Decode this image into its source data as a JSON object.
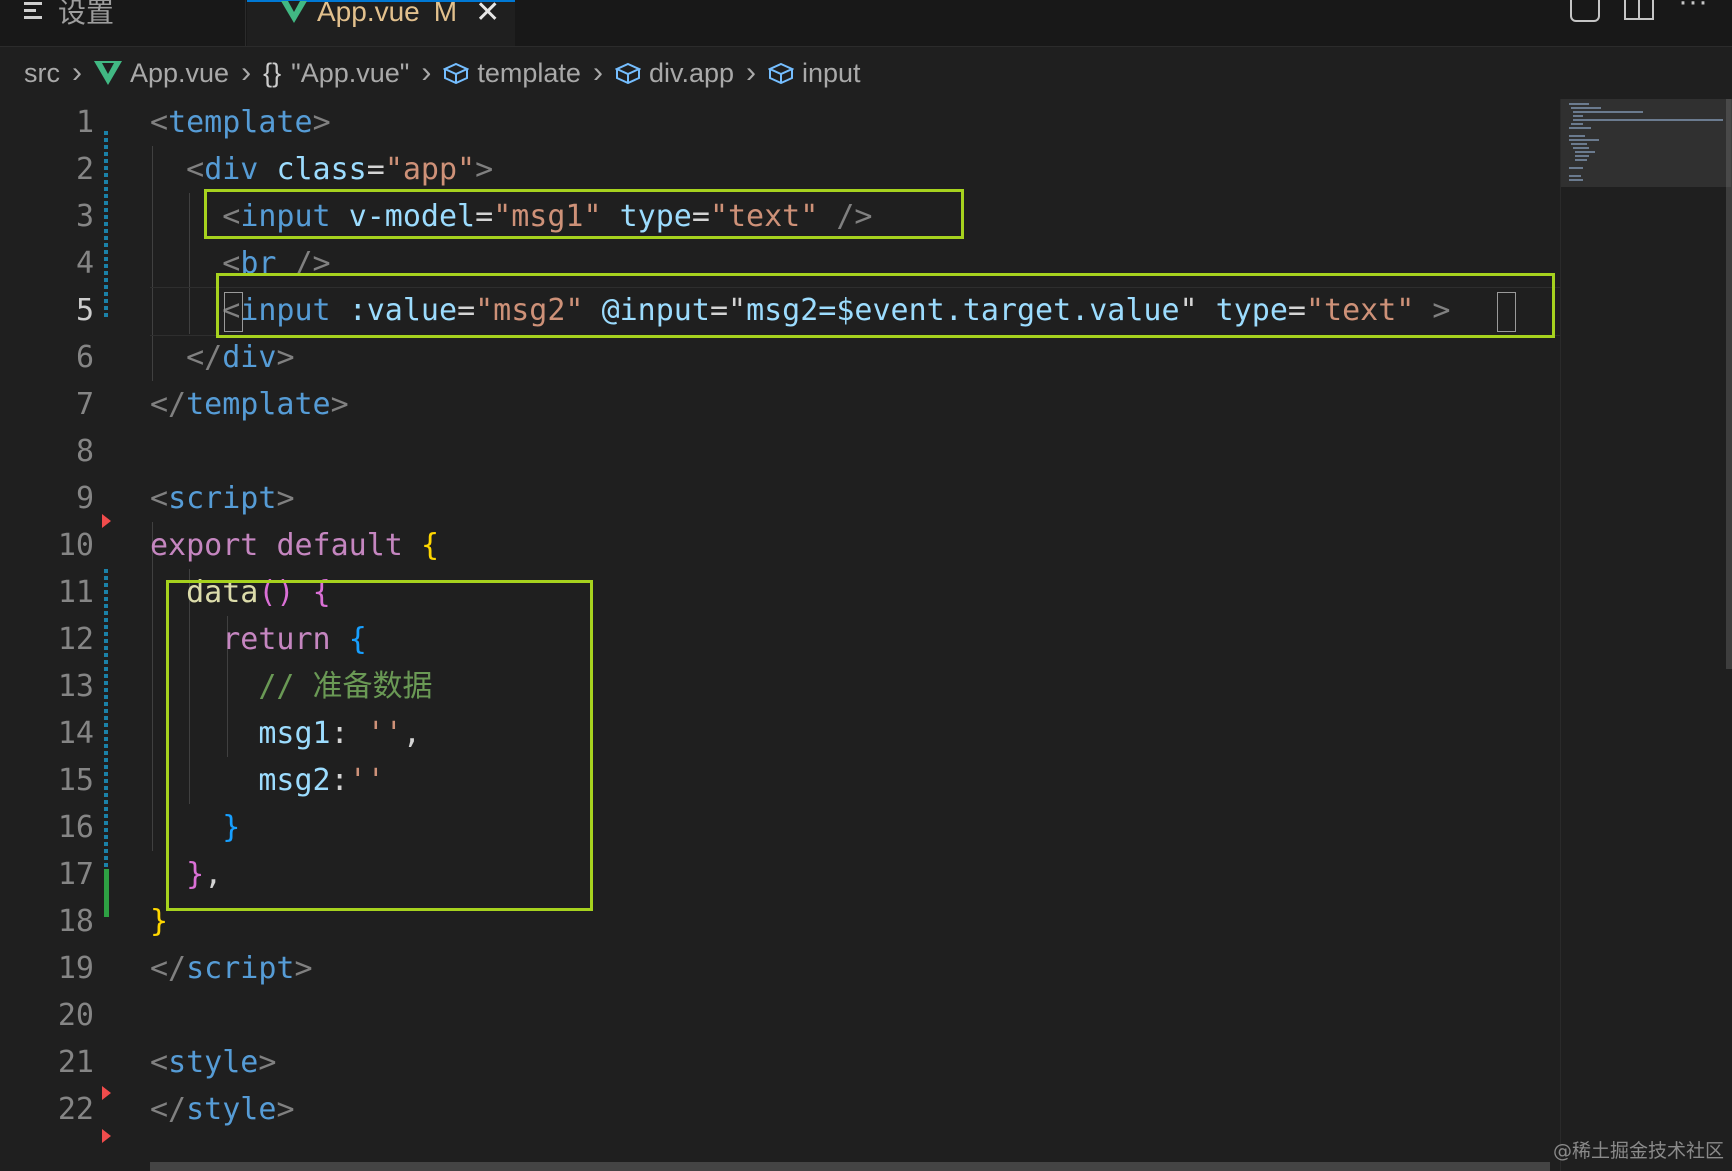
{
  "tabs": {
    "settings_label": "设置",
    "active": {
      "label": "App.vue",
      "status": "M",
      "close": "✕"
    }
  },
  "breadcrumb": {
    "items": [
      "src",
      "App.vue",
      "\"App.vue\"",
      "template",
      "div.app",
      "input"
    ],
    "braces": "{}",
    "separator": "›"
  },
  "editor": {
    "current_line": 5,
    "line_numbers": [
      "1",
      "2",
      "3",
      "4",
      "5",
      "6",
      "7",
      "8",
      "9",
      "10",
      "11",
      "12",
      "13",
      "14",
      "15",
      "16",
      "17",
      "18",
      "19",
      "20",
      "21",
      "22"
    ],
    "tokens": {
      "l1": [
        "<",
        "template",
        ">"
      ],
      "l2": [
        "<",
        "div",
        "class",
        "=",
        "\"app\"",
        ">"
      ],
      "l3": [
        "<",
        "input",
        "v-model",
        "=",
        "\"msg1\"",
        "type",
        "=",
        "\"text\"",
        "/>"
      ],
      "l4": [
        "<",
        "br",
        "/>"
      ],
      "l5": [
        "<",
        "input",
        ":value",
        "=",
        "\"msg2\"",
        "@input",
        "=",
        "\"",
        "msg2=$event.target.value",
        "\"",
        "type",
        "=",
        "\"text\"",
        ">"
      ],
      "l6": [
        "</",
        "div",
        ">"
      ],
      "l7": [
        "</",
        "template",
        ">"
      ],
      "l9": [
        "<",
        "script",
        ">"
      ],
      "l10": [
        "export",
        "default",
        "{"
      ],
      "l11": [
        "data",
        "()",
        "{"
      ],
      "l12": [
        "return",
        "{"
      ],
      "l13": [
        "// 准备数据"
      ],
      "l14": [
        "msg1",
        ":",
        "''",
        ","
      ],
      "l15": [
        "msg2",
        ":",
        "''"
      ],
      "l16": [
        "}"
      ],
      "l17": [
        "}",
        ","
      ],
      "l18": [
        "}"
      ],
      "l19": [
        "</",
        "script",
        ">"
      ],
      "l21": [
        "<",
        "style",
        ">"
      ],
      "l22": [
        "</",
        "style",
        ">"
      ]
    }
  },
  "watermark": "@稀土掘金技术社区",
  "colors": {
    "highlight_box": "#a6d21e",
    "tag": "#569cd6",
    "attribute": "#9cdcfe",
    "string": "#ce9178",
    "keyword": "#c586c0",
    "function": "#dcdcaa",
    "comment": "#6a9955",
    "vue_logo": "#41b883",
    "modified_tab": "#e2c08d"
  },
  "icons": [
    "menu-lines-icon",
    "vue-logo-icon",
    "close-icon",
    "compare-changes-icon",
    "split-editor-icon",
    "more-actions-icon",
    "chevron-right-icon",
    "braces-icon",
    "symbol-cube-icon"
  ]
}
